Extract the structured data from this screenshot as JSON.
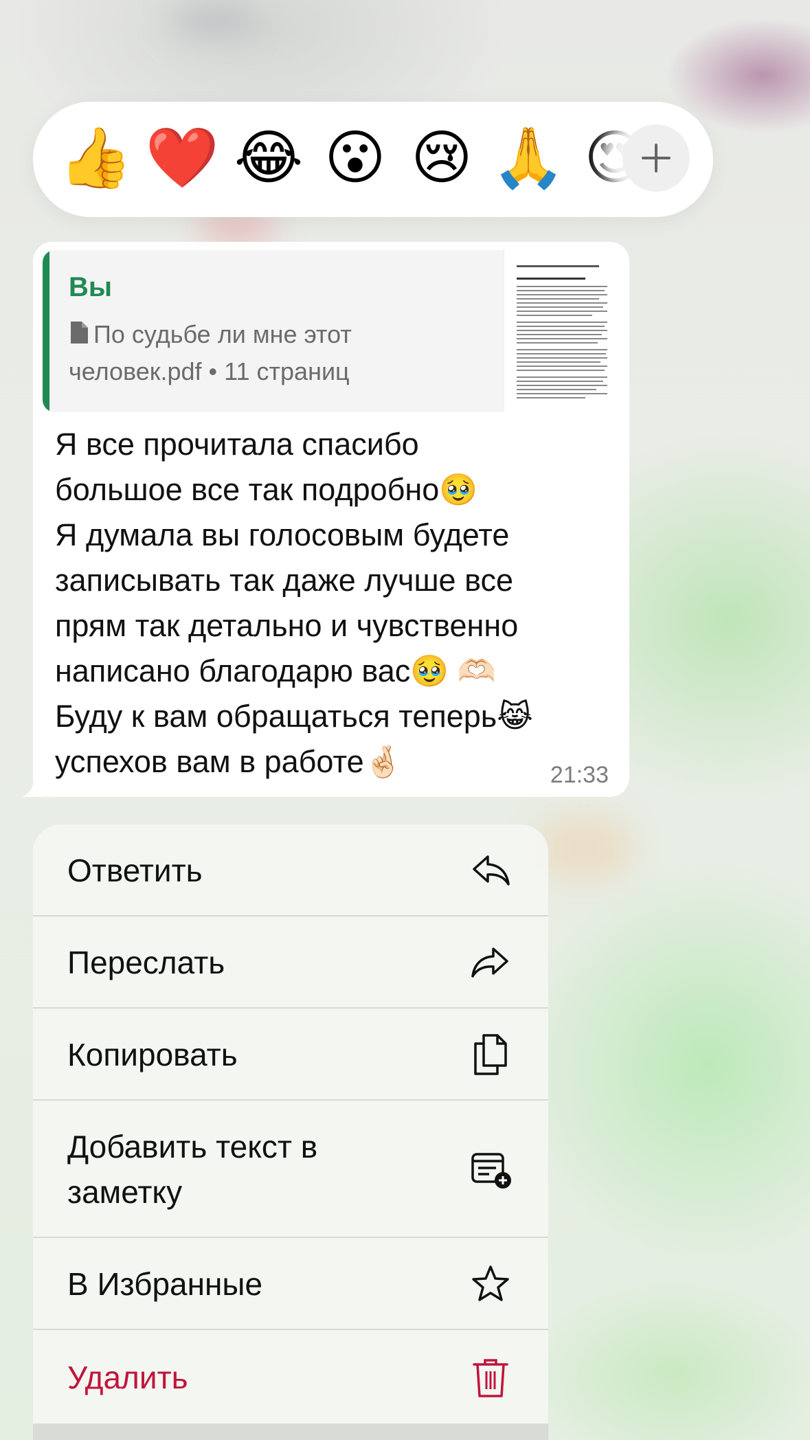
{
  "reactions": {
    "emojis": [
      {
        "char": "👍",
        "icon": "thumbs-up-icon"
      },
      {
        "char": "❤️",
        "icon": "heart-icon"
      },
      {
        "char": "😂",
        "icon": "tears-of-joy-icon"
      },
      {
        "char": "😮",
        "icon": "surprised-face-icon"
      },
      {
        "char": "😢",
        "icon": "crying-face-icon"
      },
      {
        "char": "🙏",
        "icon": "folded-hands-icon"
      },
      {
        "char": "😍",
        "icon": "heart-eyes-icon"
      }
    ],
    "more_icon": "plus-icon"
  },
  "message": {
    "quote": {
      "author": "Вы",
      "file_line1": "По судьбе ли мне этот",
      "file_line2": "человек.pdf • 11 страниц"
    },
    "text": "Я все прочитала спасибо\nбольшое все так подробно🥹\nЯ думала вы голосовым будете\nзаписывать так даже лучше все\nпрям так детально и чувственно\nнаписано благодарю вас🥹 🫶🏻\nБуду к вам обращаться теперь😹\nуспехов вам в работе🤞🏻",
    "time": "21:33"
  },
  "menu": {
    "items": [
      {
        "label": "Ответить",
        "icon": "reply-icon"
      },
      {
        "label": "Переслать",
        "icon": "forward-icon"
      },
      {
        "label": "Копировать",
        "icon": "copy-icon"
      },
      {
        "label": "Добавить текст в заметку",
        "icon": "add-note-icon"
      },
      {
        "label": "В Избранные",
        "icon": "star-icon"
      },
      {
        "label": "Удалить",
        "icon": "trash-icon"
      }
    ]
  },
  "colors": {
    "accent_green": "#1f8a52",
    "delete_red": "#c0143c"
  }
}
